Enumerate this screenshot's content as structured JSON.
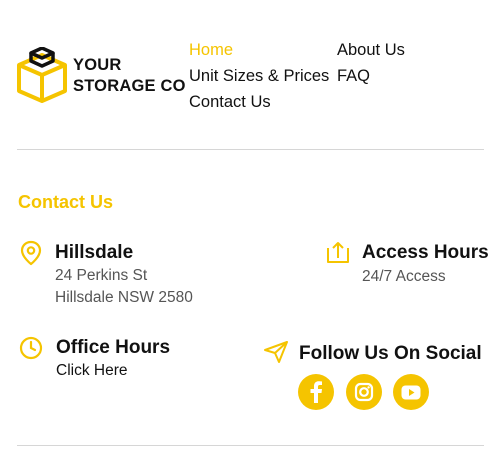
{
  "brand": {
    "line1": "YOUR",
    "line2": "STORAGE CO"
  },
  "nav": {
    "home": "Home",
    "unit_sizes": "Unit Sizes & Prices",
    "contact": "Contact Us",
    "about": "About Us",
    "faq": "FAQ"
  },
  "contact_section": {
    "title": "Contact Us",
    "location": {
      "heading": "Hillsdale",
      "address_line1": "24 Perkins St",
      "address_line2": "Hillsdale NSW 2580"
    },
    "access": {
      "heading": "Access Hours",
      "value": "24/7 Access"
    },
    "office": {
      "heading": "Office Hours",
      "link": "Click Here"
    },
    "social": {
      "heading": "Follow Us On Social",
      "networks": [
        "facebook-icon",
        "instagram-icon",
        "youtube-icon"
      ]
    }
  },
  "colors": {
    "accent": "#f5c400",
    "text": "#111111",
    "muted": "#555555",
    "divider": "#d6d6d6"
  }
}
